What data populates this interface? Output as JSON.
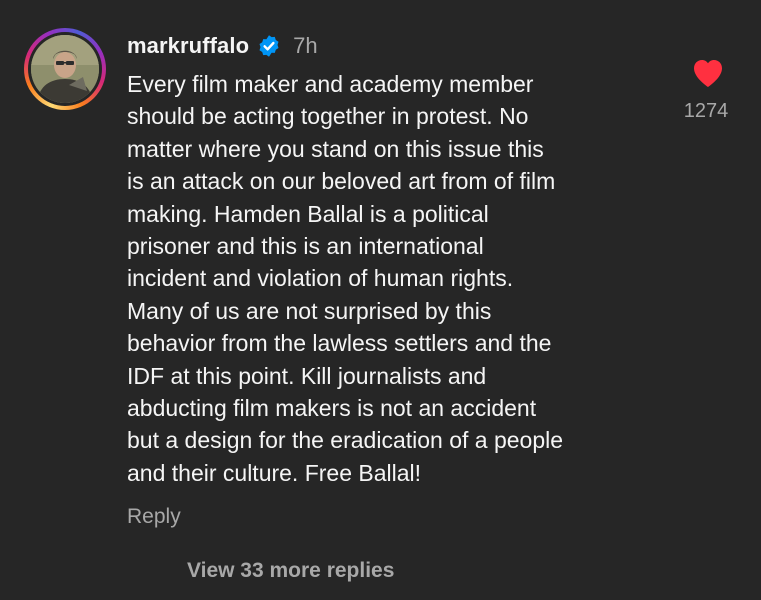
{
  "comment": {
    "username": "markruffalo",
    "verified_icon": "verified-badge-icon",
    "time": "7h",
    "text_lines": [
      "Every film maker and academy member",
      "should be acting together in protest. No",
      "matter where you stand on this issue this",
      "is an attack on our beloved art from of film",
      "making. Hamden Ballal is a political",
      "prisoner and this is an international",
      "incident and violation of human rights.",
      "Many of us are not surprised by this",
      "behavior from the lawless settlers and the",
      "IDF at this point. Kill journalists and",
      "abducting film makers is not an accident",
      "but a design for the eradication of a people",
      "and their culture. Free Ballal!"
    ],
    "reply_label": "Reply",
    "like_icon": "heart-icon",
    "like_count": "1274",
    "view_replies_label": "View 33 more replies"
  },
  "colors": {
    "background": "#262626",
    "text_primary": "#f5f5f5",
    "text_secondary": "#a8a8a8",
    "like_red": "#ff3040",
    "verified_blue": "#0095f6"
  }
}
